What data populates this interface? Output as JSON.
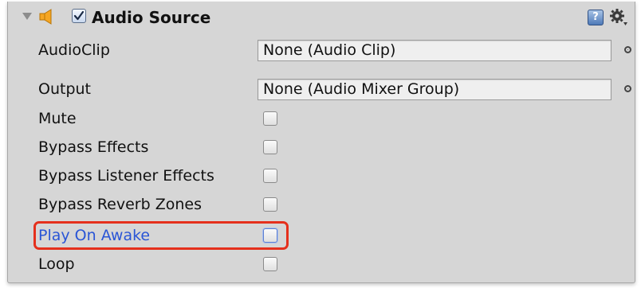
{
  "component": {
    "title": "Audio Source",
    "enabled": true,
    "icons": {
      "foldout": "foldout-triangle-icon",
      "speaker": "speaker-icon",
      "help": "help-icon",
      "help_glyph": "?",
      "settings": "gear-icon"
    }
  },
  "properties": {
    "audio_clip": {
      "label": "AudioClip",
      "value": "None (Audio Clip)"
    },
    "output": {
      "label": "Output",
      "value": "None (Audio Mixer Group)"
    },
    "mute": {
      "label": "Mute",
      "checked": false
    },
    "bypass_effects": {
      "label": "Bypass Effects",
      "checked": false
    },
    "bypass_listener_effects": {
      "label": "Bypass Listener Effects",
      "checked": false
    },
    "bypass_reverb_zones": {
      "label": "Bypass Reverb Zones",
      "checked": false
    },
    "play_on_awake": {
      "label": "Play On Awake",
      "checked": false,
      "focused": true
    },
    "loop": {
      "label": "Loop",
      "checked": false
    }
  },
  "colors": {
    "panel_bg": "#d6d6d6",
    "focused_label": "#2a55d6",
    "callout_border": "#e5301c",
    "speaker_icon": "#f5a623"
  }
}
